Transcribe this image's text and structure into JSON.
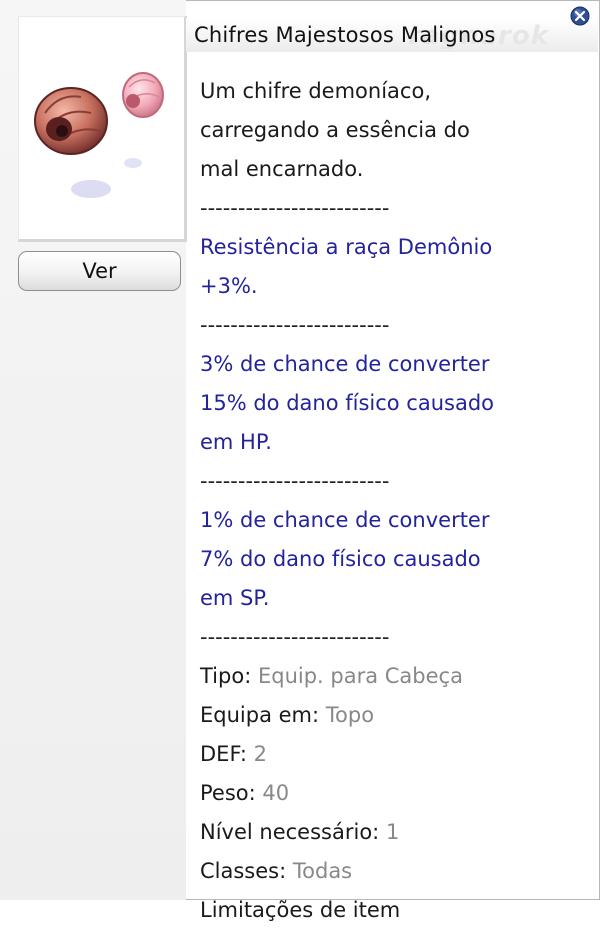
{
  "window": {
    "title": "Chifres Majestosos Malignos",
    "watermark": "ragnarok"
  },
  "icons": {
    "close": "close-icon",
    "item": "horn-item-icon"
  },
  "view_button_label": "Ver",
  "description": {
    "intro": [
      "Um chifre demoníaco,",
      "carregando a essência do",
      "mal encarnado."
    ],
    "separator": "-------------------------",
    "effect1": [
      "Resistência a raça Demônio",
      "+3%."
    ],
    "effect2": [
      "3% de chance de converter",
      "15% do dano físico causado",
      "em HP."
    ],
    "effect3": [
      "1% de chance de converter",
      "7% do dano físico causado",
      "em SP."
    ]
  },
  "properties": [
    {
      "label": "Tipo:",
      "value": "Equip. para Cabeça"
    },
    {
      "label": "Equipa em:",
      "value": "Topo"
    },
    {
      "label": "DEF:",
      "value": "2"
    },
    {
      "label": "Peso:",
      "value": "40"
    },
    {
      "label": "Nível necessário:",
      "value": "1"
    },
    {
      "label": "Classes:",
      "value": "Todas"
    }
  ],
  "partial_label": "Limitações de item",
  "colors": {
    "effect_text": "#23239c",
    "property_value": "#888888"
  }
}
